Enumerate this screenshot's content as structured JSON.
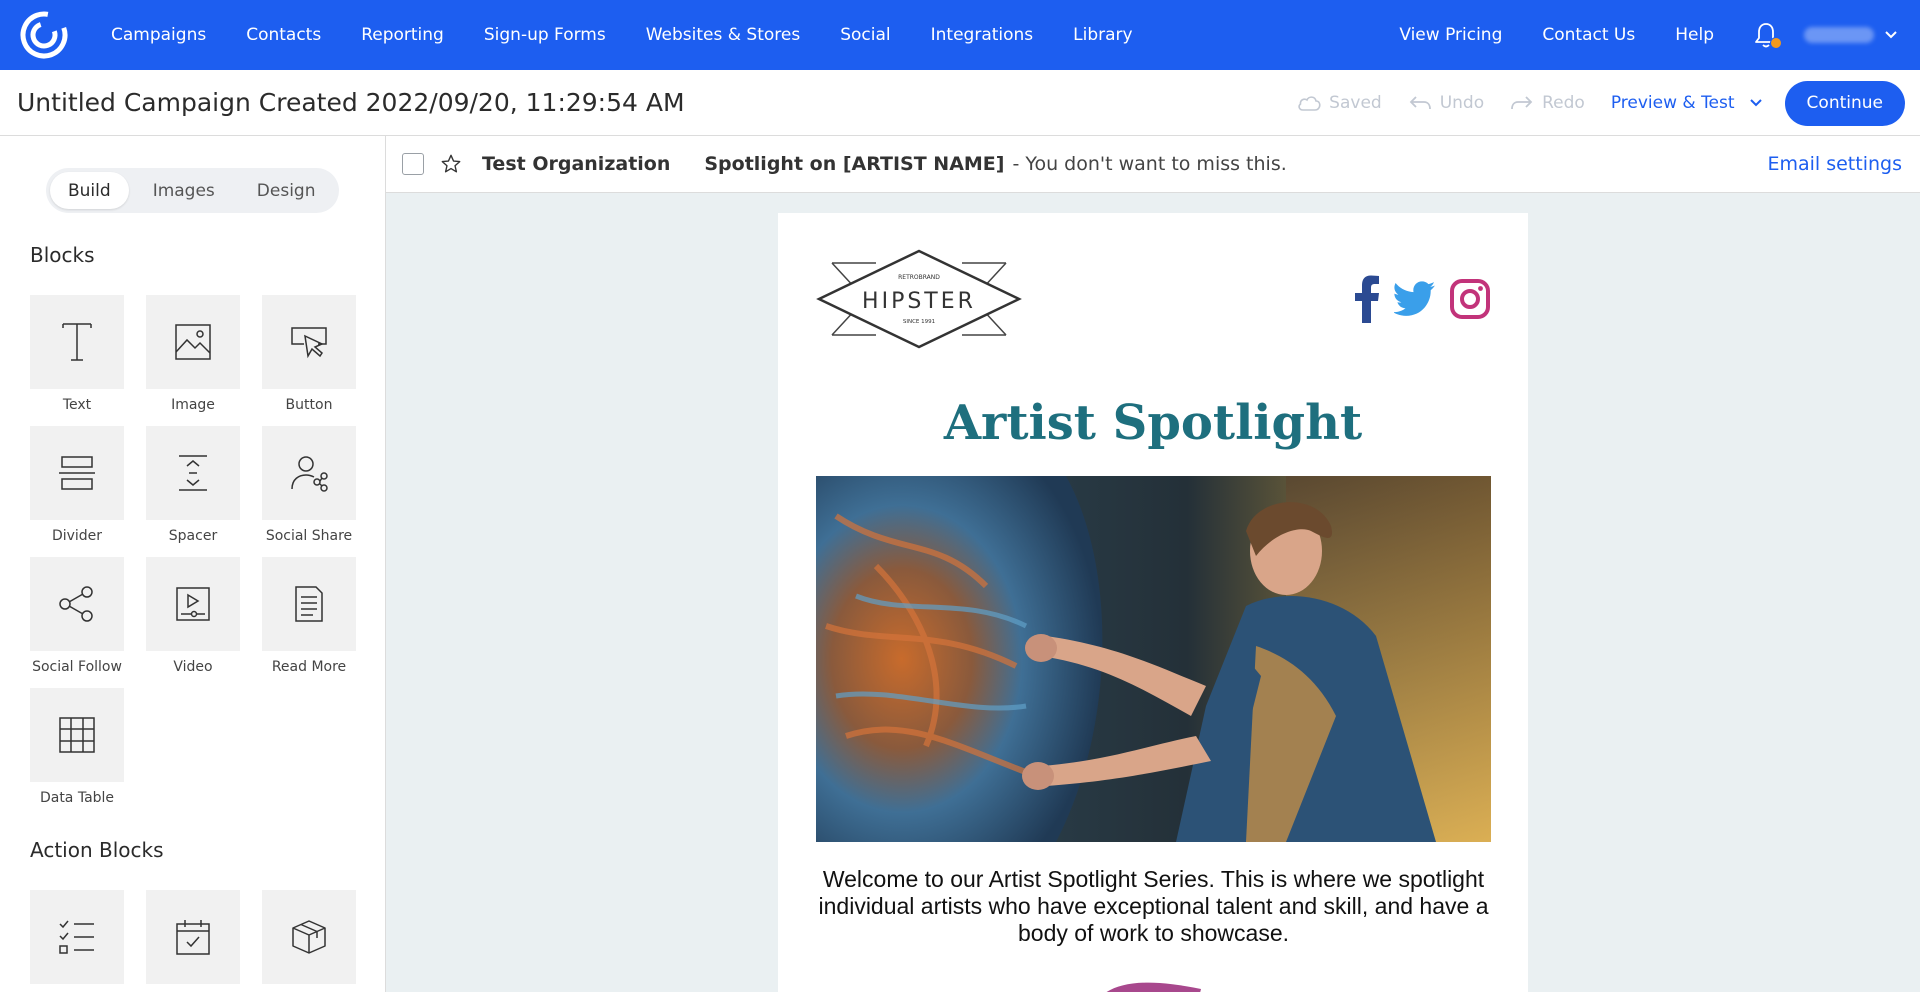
{
  "topnav": {
    "items": [
      "Campaigns",
      "Contacts",
      "Reporting",
      "Sign-up Forms",
      "Websites & Stores",
      "Social",
      "Integrations",
      "Library"
    ],
    "right_items": [
      "View Pricing",
      "Contact Us",
      "Help"
    ],
    "brand_color": "#1d5ef0",
    "notification_dot_color": "#f39a1c"
  },
  "campaign": {
    "title": "Untitled Campaign Created 2022/09/20, 11:29:54 AM",
    "saved_label": "Saved",
    "undo_label": "Undo",
    "redo_label": "Redo",
    "preview_label": "Preview & Test",
    "continue_label": "Continue"
  },
  "sidebar": {
    "tabs": [
      "Build",
      "Images",
      "Design"
    ],
    "active_tab": "Build",
    "blocks_title": "Blocks",
    "blocks": [
      {
        "label": "Text",
        "icon": "text-icon"
      },
      {
        "label": "Image",
        "icon": "image-icon"
      },
      {
        "label": "Button",
        "icon": "button-icon"
      },
      {
        "label": "Divider",
        "icon": "divider-icon"
      },
      {
        "label": "Spacer",
        "icon": "spacer-icon"
      },
      {
        "label": "Social Share",
        "icon": "social-share-icon"
      },
      {
        "label": "Social Follow",
        "icon": "social-follow-icon"
      },
      {
        "label": "Video",
        "icon": "video-icon"
      },
      {
        "label": "Read More",
        "icon": "read-more-icon"
      },
      {
        "label": "Data Table",
        "icon": "data-table-icon"
      }
    ],
    "action_blocks_title": "Action Blocks",
    "action_blocks": [
      {
        "icon": "checklist-icon"
      },
      {
        "icon": "calendar-check-icon"
      },
      {
        "icon": "box-icon"
      }
    ]
  },
  "email_header": {
    "organization": "Test Organization",
    "subject": "Spotlight on [ARTIST NAME]",
    "preheader": "- You don't want to miss this.",
    "settings_label": "Email settings"
  },
  "email": {
    "logo": {
      "top_text": "RETROBRAND",
      "main_text": "HIPSTER",
      "bottom_text": "SINCE 1991"
    },
    "title": "Artist Spotlight",
    "title_color": "#1e6f7e",
    "body": "Welcome to our Artist Spotlight Series. This is where we spotlight individual artists who have exceptional talent and skill, and have a body of work to showcase.",
    "social_icons": [
      "facebook-icon",
      "twitter-icon",
      "instagram-icon"
    ]
  }
}
